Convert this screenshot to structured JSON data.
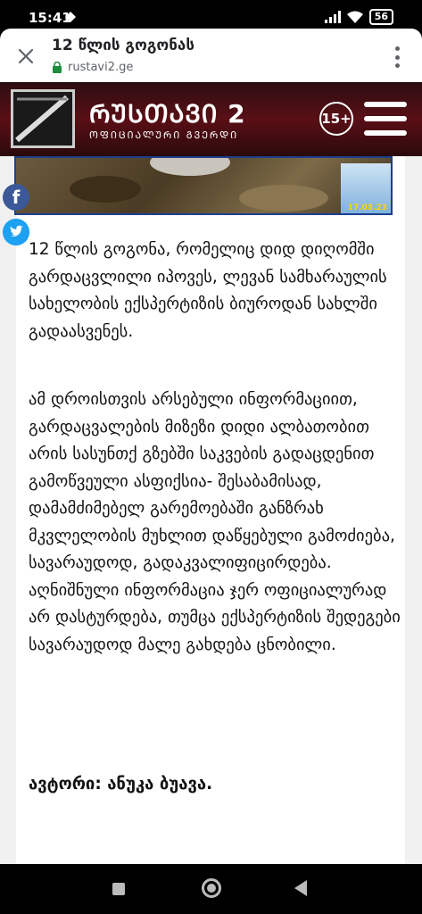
{
  "status_bar": {
    "time": "15:41",
    "battery": "56",
    "icons": [
      "navigation-arrow-icon",
      "signal-icon",
      "wifi-icon",
      "battery-icon"
    ]
  },
  "browser": {
    "title": "12 წლის გოგონას",
    "url": "rustavi2.ge",
    "icons": [
      "close-icon",
      "lock-icon",
      "more-vert-icon"
    ]
  },
  "site_header": {
    "logo_text": "ᲠᲣᲡᲗᲐᲕᲘ 2",
    "logo_subtitle": "ᲝᲤᲘᲪᲘᲐᲚᲣᲠᲘ ᲒᲕᲔᲠᲓᲘ",
    "age_rating": "15+",
    "menu_icon": "hamburger-icon"
  },
  "photo": {
    "date_stamp": "17.03.23"
  },
  "share": {
    "facebook_label": "f",
    "icons": [
      "facebook-icon",
      "twitter-icon"
    ]
  },
  "article": {
    "paragraph_1": "12 წლის გოგონა, რომელიც დიდ დიღომში გარდაცვლილი იპოვეს, ლევან სამხარაულის სახელობის ექსპერტიზის ბიუროდან სახლში გადაასვენეს.",
    "paragraph_2": "ამ დროისთვის არსებული ინფორმაციით, გარდაცვალების მიზეზი დიდი ალბათობით არის სასუნთქ გზებში საკვების გადაცდენით გამოწვეული ასფიქსია- შესაბამისად, დამამძიმებელ გარემოებაში განზრახ მკვლელობის მუხლით დაწყებული გამოძიება, სავარაუდოდ, გადაკვალიფიცირდება. აღნიშნული ინფორმაცია ჯერ ოფიციალურად არ დასტურდება, თუმცა ექსპერტიზის შედეგები სავარაუდოდ მალე გახდება ცნობილი.",
    "author": "ავტორი: ანუკა ბუავა."
  },
  "nav_bar": {
    "icons": [
      "recents-square-icon",
      "home-circle-icon",
      "back-triangle-icon"
    ]
  },
  "colors": {
    "header_bg": "#5a0f16",
    "facebook": "#3b5998",
    "twitter": "#1da1f2",
    "lock_green": "#1e8e3e",
    "photo_border": "#1d3f8f"
  }
}
